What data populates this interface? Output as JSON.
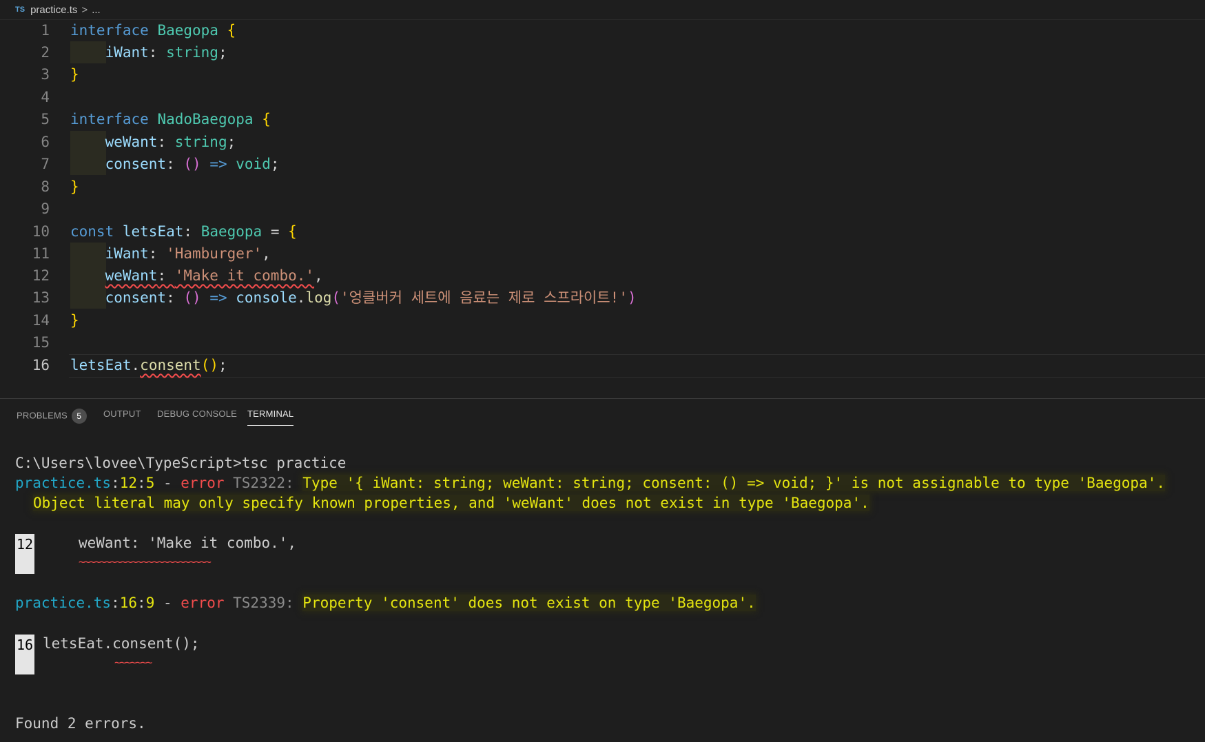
{
  "breadcrumb": {
    "lang_icon": "TS",
    "file": "practice.ts",
    "separator": ">",
    "ellipsis": "..."
  },
  "editor": {
    "lines": [
      {
        "n": "1"
      },
      {
        "n": "2"
      },
      {
        "n": "3"
      },
      {
        "n": "4"
      },
      {
        "n": "5"
      },
      {
        "n": "6"
      },
      {
        "n": "7"
      },
      {
        "n": "8"
      },
      {
        "n": "9"
      },
      {
        "n": "10"
      },
      {
        "n": "11"
      },
      {
        "n": "12"
      },
      {
        "n": "13"
      },
      {
        "n": "14"
      },
      {
        "n": "15"
      },
      {
        "n": "16"
      }
    ],
    "code": {
      "l1": {
        "kw": "interface",
        "name": "Baegopa",
        "brace": "{"
      },
      "l2": {
        "prop": "iWant",
        "colon": ": ",
        "type": "string",
        "end": ";"
      },
      "l3": {
        "brace": "}"
      },
      "l5": {
        "kw": "interface",
        "name": "NadoBaegopa",
        "brace": "{"
      },
      "l6": {
        "prop": "weWant",
        "colon": ": ",
        "type": "string",
        "end": ";"
      },
      "l7": {
        "prop": "consent",
        "colon": ": ",
        "parens": "()",
        "arrow": " => ",
        "type": "void",
        "end": ";"
      },
      "l8": {
        "brace": "}"
      },
      "l10": {
        "kw": "const",
        "name": "letsEat",
        "colon": ": ",
        "type": "Baegopa",
        "eq": " = ",
        "brace": "{"
      },
      "l11": {
        "prop": "iWant",
        "colon": ": ",
        "str": "'Hamburger'",
        "end": ","
      },
      "l12": {
        "prop": "weWant",
        "colon": ": ",
        "str": "'Make it combo.'",
        "end": ","
      },
      "l13": {
        "prop": "consent",
        "colon": ": ",
        "parens": "()",
        "arrow": " => ",
        "obj": "console",
        "dot": ".",
        "fn": "log",
        "open": "(",
        "str": "'엉클버커 세트에 음료는 제로 스프라이트!'",
        "close": ")"
      },
      "l14": {
        "brace": "}"
      },
      "l16": {
        "obj": "letsEat",
        "dot": ".",
        "fn": "consent",
        "parens": "()",
        "end": ";"
      }
    }
  },
  "panel": {
    "tabs": {
      "problems": "PROBLEMS",
      "problems_count": "5",
      "output": "OUTPUT",
      "debug": "DEBUG CONSOLE",
      "terminal": "TERMINAL"
    }
  },
  "terminal": {
    "prompt": "C:\\Users\\lovee\\TypeScript>tsc practice",
    "e1": {
      "file": "practice.ts",
      "colon": ":",
      "line": "12",
      "col": "5",
      "dash": " - ",
      "err": "error",
      "code": " TS2322: ",
      "msg": "Type '{ iWant: string; weWant: string; consent: () => void; }' is not assignable to type 'Baegopa'.",
      "msg2": "Object literal may only specify known properties, and 'weWant' does not exist in type 'Baegopa'."
    },
    "snippet1": {
      "ln": "12",
      "text": "weWant: 'Make it combo.',",
      "tilde": "~~~~~~~~~~~~~~~~~~~~~~~~~"
    },
    "e2": {
      "file": "practice.ts",
      "colon": ":",
      "line": "16",
      "col": "9",
      "dash": " - ",
      "err": "error",
      "code": " TS2339: ",
      "msg": "Property 'consent' does not exist on type 'Baegopa'."
    },
    "snippet2": {
      "ln": "16",
      "text": "letsEat.consent();",
      "tilde": "~~~~~~~"
    },
    "footer": "Found 2 errors."
  }
}
